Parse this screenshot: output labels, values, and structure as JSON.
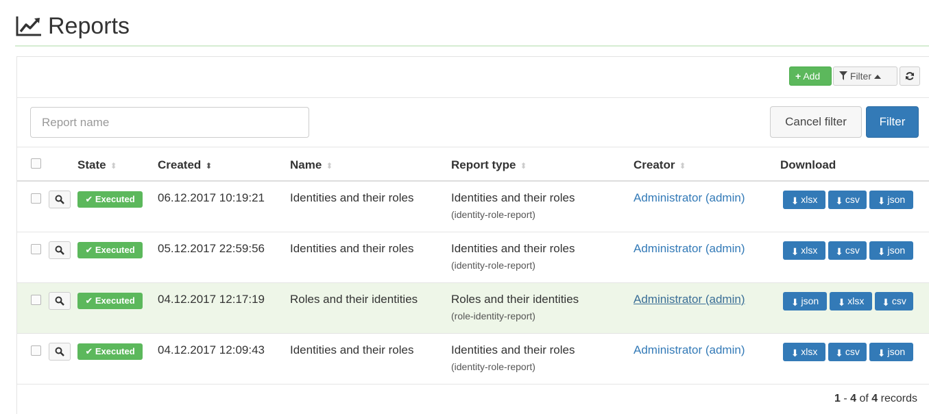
{
  "header": {
    "title": "Reports",
    "icon": "line-chart-icon"
  },
  "toolbar": {
    "add_label": "Add",
    "filter_label": "Filter",
    "refresh_icon": "refresh-icon"
  },
  "filter": {
    "placeholder": "Report name",
    "cancel_label": "Cancel filter",
    "apply_label": "Filter"
  },
  "columns": {
    "state": "State",
    "created": "Created",
    "name": "Name",
    "report_type": "Report type",
    "creator": "Creator",
    "download": "Download"
  },
  "rows": [
    {
      "state": "Executed",
      "created": "06.12.2017 10:19:21",
      "name": "Identities and their roles",
      "type": "Identities and their roles",
      "type_code": "(identity-role-report)",
      "creator": "Administrator (admin)",
      "downloads": [
        "xlsx",
        "csv",
        "json"
      ]
    },
    {
      "state": "Executed",
      "created": "05.12.2017 22:59:56",
      "name": "Identities and their roles",
      "type": "Identities and their roles",
      "type_code": "(identity-role-report)",
      "creator": "Administrator (admin)",
      "downloads": [
        "xlsx",
        "csv",
        "json"
      ]
    },
    {
      "state": "Executed",
      "created": "04.12.2017 12:17:19",
      "name": "Roles and their identities",
      "type": "Roles and their identities",
      "type_code": "(role-identity-report)",
      "creator": "Administrator (admin)",
      "downloads": [
        "json",
        "xlsx",
        "csv"
      ]
    },
    {
      "state": "Executed",
      "created": "04.12.2017 12:09:43",
      "name": "Identities and their roles",
      "type": "Identities and their roles",
      "type_code": "(identity-role-report)",
      "creator": "Administrator (admin)",
      "downloads": [
        "xlsx",
        "csv",
        "json"
      ]
    }
  ],
  "pagination": {
    "from": "1",
    "to": "4",
    "of_label": "of",
    "total": "4",
    "records_label": "records"
  },
  "colors": {
    "accent": "#337ab7",
    "success": "#5cb85c",
    "highlight_row": "#eef6e8"
  }
}
